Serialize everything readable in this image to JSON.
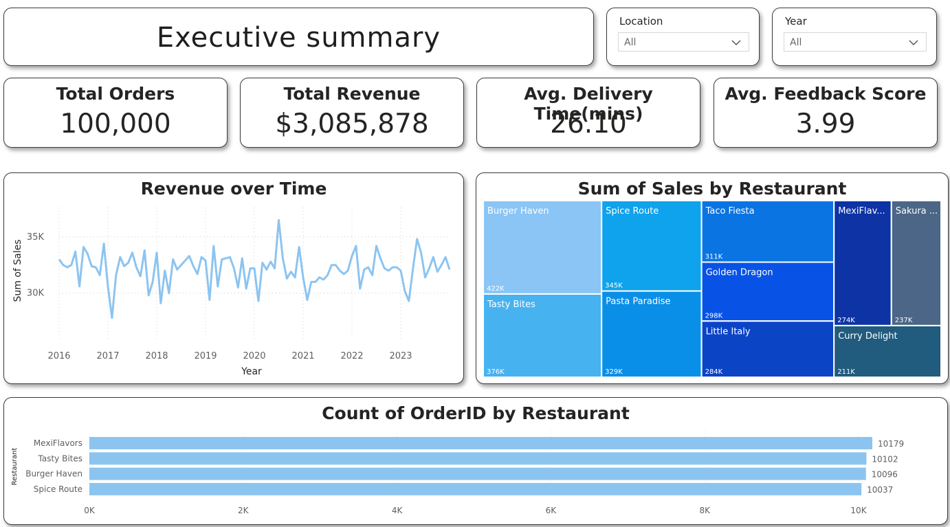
{
  "header": {
    "title": "Executive summary"
  },
  "filters": {
    "location": {
      "label": "Location",
      "value": "All"
    },
    "year": {
      "label": "Year",
      "value": "All"
    }
  },
  "kpis": [
    {
      "label": "Total Orders",
      "value": "100,000"
    },
    {
      "label": "Total Revenue",
      "value": "$3,085,878"
    },
    {
      "label": "Avg. Delivery Time(mins)",
      "value": "26.10"
    },
    {
      "label": "Avg. Feedback Score",
      "value": "3.99"
    }
  ],
  "chart_data": [
    {
      "type": "line",
      "title": "Revenue over Time",
      "xlabel": "Year",
      "ylabel": "Sum of Sales",
      "x_ticks": [
        "2016",
        "2017",
        "2018",
        "2019",
        "2020",
        "2021",
        "2022",
        "2023"
      ],
      "y_ticks": [
        "30K",
        "35K"
      ],
      "ylim": [
        26500,
        37000
      ],
      "x_start": "2016-01",
      "series_color": "#8cc4f0",
      "values": [
        33000,
        32500,
        32300,
        32500,
        33700,
        30600,
        34100,
        33500,
        32400,
        32300,
        31600,
        34400,
        30600,
        27800,
        31600,
        33200,
        32400,
        32700,
        33600,
        32300,
        31500,
        33800,
        29800,
        31000,
        33600,
        29100,
        32000,
        30000,
        33000,
        32100,
        32500,
        32900,
        33300,
        32400,
        31700,
        33200,
        32900,
        29400,
        34200,
        30600,
        33000,
        33100,
        33200,
        32200,
        30500,
        33100,
        30400,
        32200,
        32200,
        29300,
        32700,
        32100,
        32800,
        32200,
        36500,
        33100,
        31300,
        31900,
        31400,
        34100,
        31400,
        29400,
        31000,
        31000,
        31400,
        31200,
        31600,
        32500,
        32500,
        32000,
        31700,
        32000,
        33300,
        34200,
        30400,
        32100,
        32300,
        31600,
        34200,
        33100,
        32200,
        32000,
        32300,
        32300,
        32000,
        30200,
        29300,
        32200,
        34800,
        33600,
        31400,
        32200,
        33200,
        31900,
        32500,
        33200,
        32100
      ]
    },
    {
      "type": "treemap",
      "title": "Sum of Sales by Restaurant",
      "items": [
        {
          "name": "Burger Haven",
          "label": "422K",
          "value": 422,
          "color": "#8ac5f5"
        },
        {
          "name": "Tasty Bites",
          "label": "376K",
          "value": 376,
          "color": "#47b2f0"
        },
        {
          "name": "Spice Route",
          "label": "345K",
          "value": 345,
          "color": "#0ea3ec"
        },
        {
          "name": "Pasta Paradise",
          "label": "329K",
          "value": 329,
          "color": "#0a8fe8"
        },
        {
          "name": "Taco Fiesta",
          "label": "311K",
          "value": 311,
          "color": "#0b74e3"
        },
        {
          "name": "Golden Dragon",
          "label": "298K",
          "value": 298,
          "color": "#0853e6"
        },
        {
          "name": "Little Italy",
          "label": "284K",
          "value": 284,
          "color": "#0c44c6"
        },
        {
          "name": "MexiFlav...",
          "label": "274K",
          "value": 274,
          "color": "#0d33a5"
        },
        {
          "name": "Sakura ...",
          "label": "237K",
          "value": 237,
          "color": "#4b6686"
        },
        {
          "name": "Curry Delight",
          "label": "211K",
          "value": 211,
          "color": "#215b7d"
        }
      ]
    },
    {
      "type": "bar",
      "orientation": "horizontal",
      "title": "Count of OrderID by Restaurant",
      "ylabel": "Restaurant",
      "categories": [
        "MexiFlavors",
        "Tasty Bites",
        "Burger Haven",
        "Spice Route"
      ],
      "values": [
        10179,
        10102,
        10096,
        10037
      ],
      "value_labels": [
        "10179",
        "10102",
        "10096",
        "10037"
      ],
      "x_ticks": [
        "0K",
        "2K",
        "4K",
        "6K",
        "8K",
        "10K"
      ],
      "xlim": [
        0,
        10000
      ],
      "bar_color": "#8cc4f0"
    }
  ]
}
